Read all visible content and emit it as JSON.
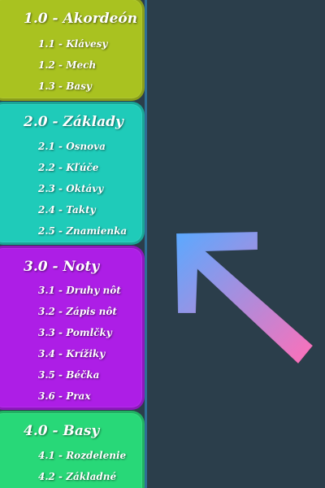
{
  "sections": [
    {
      "title": "1.0 - Akordeón",
      "color": "#a9c220",
      "items": [
        "1.1 - Klávesy",
        "1.2 - Mech",
        "1.3 - Basy"
      ]
    },
    {
      "title": "2.0 - Základy",
      "color": "#1fcbb9",
      "items": [
        "2.1 - Osnova",
        "2.2 - Kľúče",
        "2.3 - Oktávy",
        "2.4 - Takty",
        "2.5 - Znamienka"
      ]
    },
    {
      "title": "3.0 - Noty",
      "color": "#ad1ee6",
      "items": [
        "3.1 - Druhy nôt",
        "3.2 - Zápis nôt",
        "3.3 - Pomlčky",
        "3.4 - Krížiky",
        "3.5 - Béčka",
        "3.6 - Prax"
      ]
    },
    {
      "title": "4.0 - Basy",
      "color": "#28d878",
      "items": [
        "4.1 - Rozdelenie",
        "4.2 - Základné"
      ]
    }
  ],
  "background_color": "#2b3e4b",
  "divider_color": "#2f6e96",
  "arrow": {
    "icon": "arrow-up-left-icon",
    "gradient_start": "#5aa9ff",
    "gradient_end": "#ff6fb8"
  }
}
